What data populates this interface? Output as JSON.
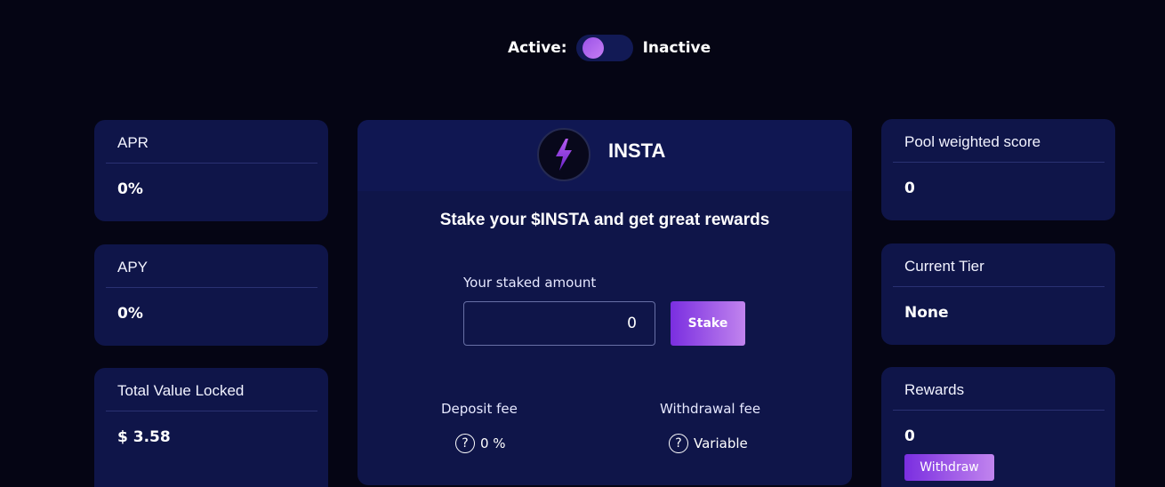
{
  "toggle": {
    "active_label": "Active:",
    "inactive_label": "Inactive"
  },
  "stats_left": {
    "apr": {
      "title": "APR",
      "value": "0%"
    },
    "apy": {
      "title": "APY",
      "value": "0%"
    },
    "tvl": {
      "title": "Total Value Locked",
      "value": "$ 3.58"
    }
  },
  "pool": {
    "token_name": "INSTA",
    "logo_icon": "lightning-bolt-icon",
    "headline": "Stake your $INSTA and get great rewards",
    "staked_label": "Your staked amount",
    "staked_value": "0",
    "stake_button": "Stake",
    "deposit_fee_label": "Deposit fee",
    "deposit_fee_value": "0 %",
    "withdrawal_fee_label": "Withdrawal fee",
    "withdrawal_fee_value": "Variable",
    "help_icon": "?"
  },
  "stats_right": {
    "score": {
      "title": "Pool weighted score",
      "value": "0"
    },
    "tier": {
      "title": "Current Tier",
      "value": "None"
    },
    "rewards": {
      "title": "Rewards",
      "value": "0",
      "withdraw_button": "Withdraw"
    }
  },
  "colors": {
    "background": "#050514",
    "card": "#0f1549",
    "accent_start": "#7a2ee0",
    "accent_end": "#c184ee"
  }
}
